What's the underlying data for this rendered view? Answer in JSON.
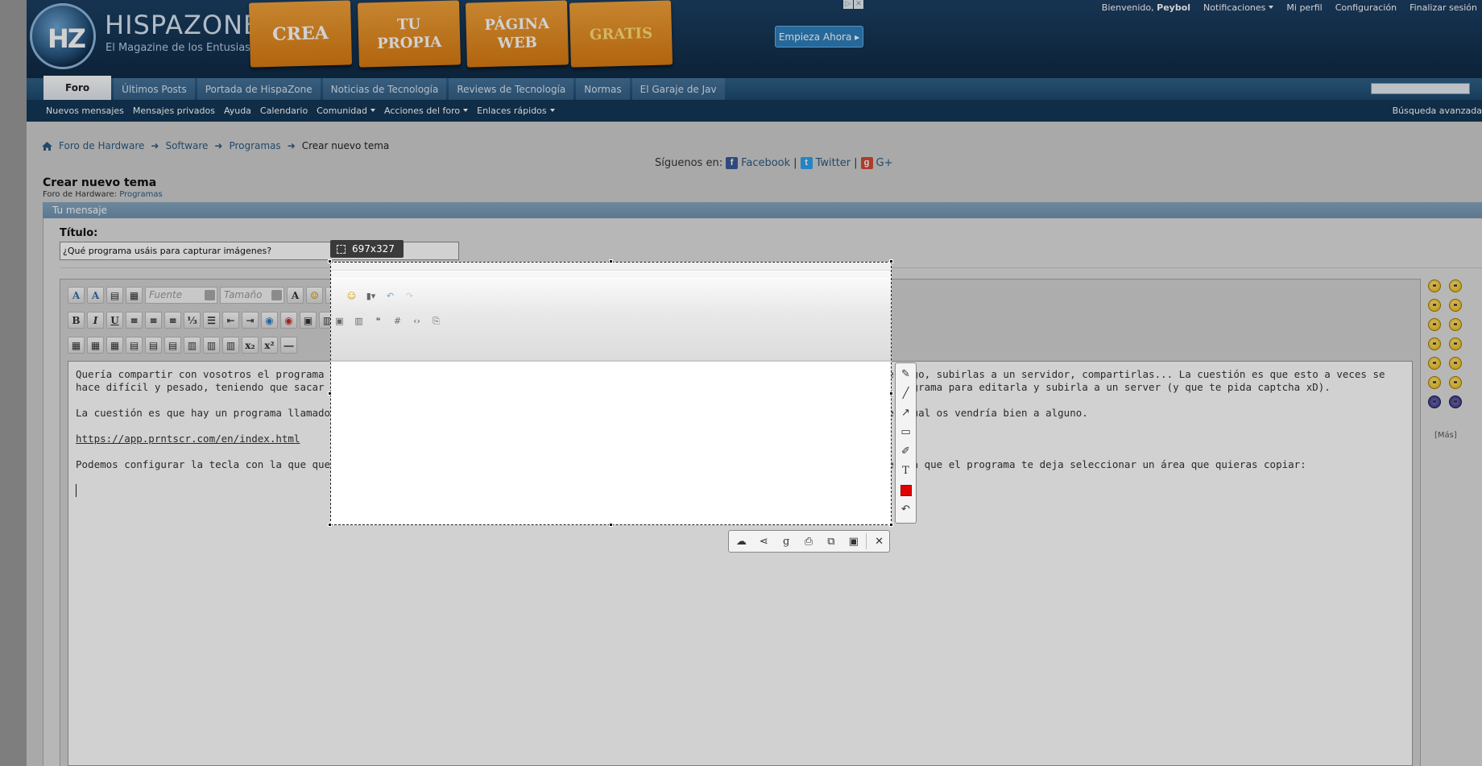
{
  "header": {
    "logo_mark": "HZ",
    "logo_title": "HISPAZONE",
    "logo_subtitle": "El Magazine de los Entusiastas",
    "ad_cards": [
      "CREA",
      "TU\nPROPIA",
      "PÁGINA\nWEB",
      "GRATIS"
    ],
    "ad_cta": "Empieza Ahora",
    "user_links": {
      "welcome": "Bienvenido,",
      "username": "Peybol",
      "notifications": "Notificaciones",
      "profile": "Mi perfil",
      "settings": "Configuración",
      "logout": "Finalizar sesión"
    }
  },
  "nav": {
    "tabs": [
      "Foro",
      "Últimos Posts",
      "Portada de HispaZone",
      "Noticias de Tecnología",
      "Reviews de Tecnología",
      "Normas",
      "El Garaje de Jav"
    ],
    "subnav": [
      "Nuevos mensajes",
      "Mensajes privados",
      "Ayuda",
      "Calendario",
      "Comunidad",
      "Acciones del foro",
      "Enlaces rápidos"
    ],
    "advanced_search": "Búsqueda avanzada"
  },
  "breadcrumb": [
    "Foro de Hardware",
    "Software",
    "Programas",
    "Crear nuevo tema"
  ],
  "follow": {
    "label": "Síguenos en:",
    "facebook": "Facebook",
    "twitter": "Twitter",
    "gplus": "G+",
    "separator": "|"
  },
  "page": {
    "title": "Crear nuevo tema",
    "subtitle_prefix": "Foro de Hardware:",
    "subtitle_link": "Programas",
    "panel_title": "Tu mensaje",
    "title_label": "Título:",
    "title_value": "¿Qué programa usáis para capturar imágenes?"
  },
  "editor": {
    "font_placeholder": "Fuente",
    "size_placeholder": "Tamaño",
    "paragraphs": [
      "Quería compartir con vosotros el programa que estoy usando para prácticamente todo, hacer capturas de pantalla, editar las capturas que hago, subirlas a un servidor, compartirlas... La cuestión es que esto a veces se hace difícil y pesado, teniendo que sacar la captura de pantalla, ponerla en algún programa, guardarla en el ordenador, abrirla con un programa para editarla y subirla a un server (y que te pida captcha xD).",
      "La cuestión es que hay un programa llamado Lightshot, el cual hace todo lo nombrado anteriormente, y en tiempo récord, y he pensado que igual os vendría bien a alguno.",
      "https://app.prntscr.com/en/index.html",
      "Podemos configurar la tecla con la que queramos que se active el programa, yo por ejemplo uso la clásica Impr. Pant. pero con la diferencia que el programa te deja seleccionar un área que quieras copiar:"
    ],
    "smilies_more": "[Más]"
  },
  "capture": {
    "size_label": "697x327",
    "color": "#e10000"
  }
}
